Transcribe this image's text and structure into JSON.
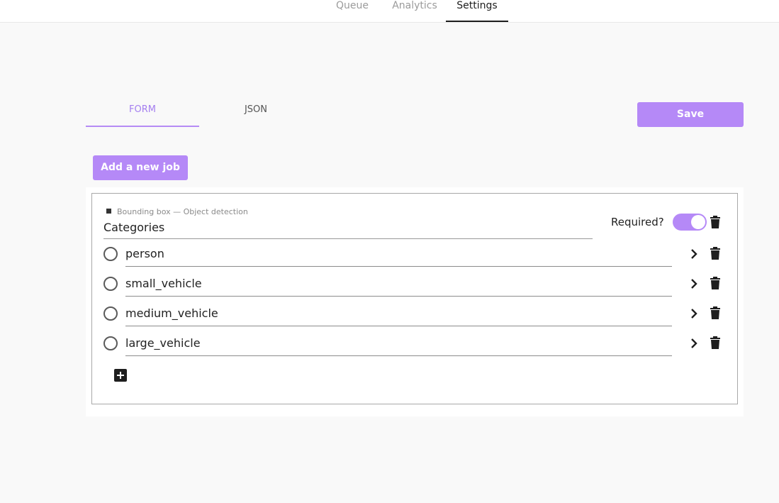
{
  "nav": {
    "tabs": [
      {
        "label": "Queue"
      },
      {
        "label": "Analytics"
      },
      {
        "label": "Settings"
      }
    ],
    "active": "Settings"
  },
  "editor": {
    "tabs": [
      {
        "label": "FORM"
      },
      {
        "label": "JSON"
      }
    ],
    "active": "FORM",
    "save_label": "Save"
  },
  "jobs": {
    "add_label": "Add a new job",
    "items": [
      {
        "type_label": "Bounding box — Object detection",
        "title": "Categories",
        "required_label": "Required?",
        "required": true,
        "categories": [
          {
            "name": "person"
          },
          {
            "name": "small_vehicle"
          },
          {
            "name": "medium_vehicle"
          },
          {
            "name": "large_vehicle"
          }
        ]
      }
    ]
  },
  "colors": {
    "accent": "#b589f7",
    "accent_text": "#a57ff0",
    "text": "#222222",
    "muted": "#9b9b9b",
    "background": "#f9f9f9"
  },
  "icons": [
    "trash-icon",
    "chevron-right-icon",
    "plus-icon",
    "radio-icon"
  ]
}
